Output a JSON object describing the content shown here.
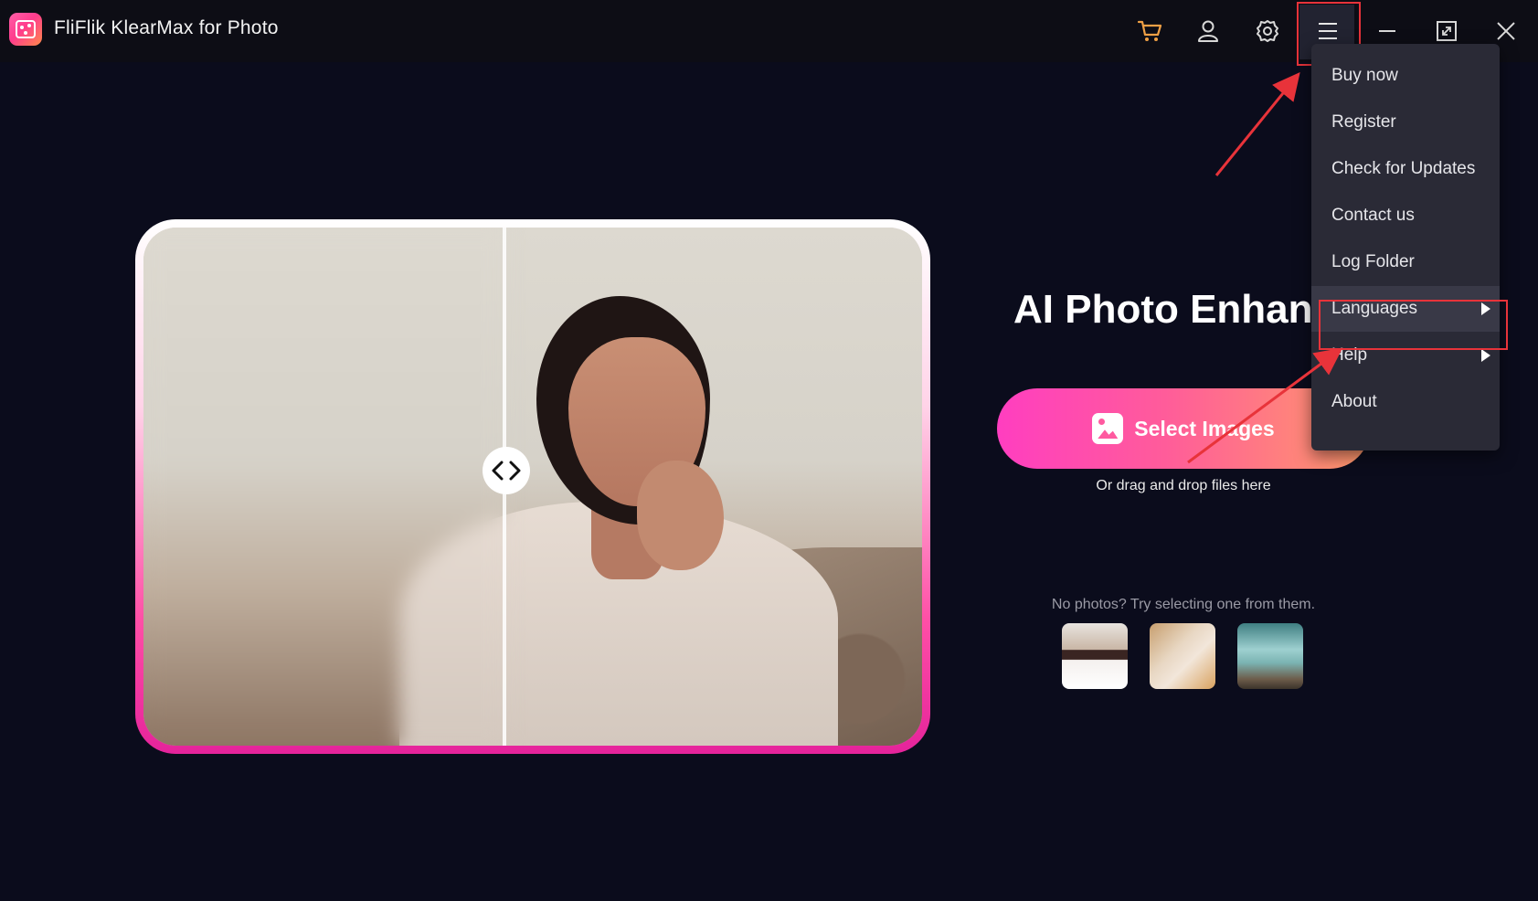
{
  "window": {
    "title": "FliFlik KlearMax for Photo"
  },
  "toolbar": {
    "icons": [
      "cart-icon",
      "account-icon",
      "settings-icon",
      "menu-icon",
      "minimize-icon",
      "maximize-icon",
      "close-icon"
    ]
  },
  "main": {
    "headline": "AI Photo Enhanc",
    "select_button_label": "Select Images",
    "drag_hint": "Or drag and drop files here",
    "samples_hint": "No photos? Try selecting one from them."
  },
  "menu": {
    "items": [
      {
        "label": "Buy now"
      },
      {
        "label": "Register"
      },
      {
        "label": "Check for Updates"
      },
      {
        "label": "Contact us"
      },
      {
        "label": "Log Folder"
      },
      {
        "label": "Languages"
      },
      {
        "label": "Help"
      },
      {
        "label": "About"
      }
    ]
  },
  "colors": {
    "background": "#0b0c1c",
    "accent_pink": "#ff3ec0",
    "accent_orange": "#ff9a6a",
    "annotation_red": "#e8333a"
  }
}
